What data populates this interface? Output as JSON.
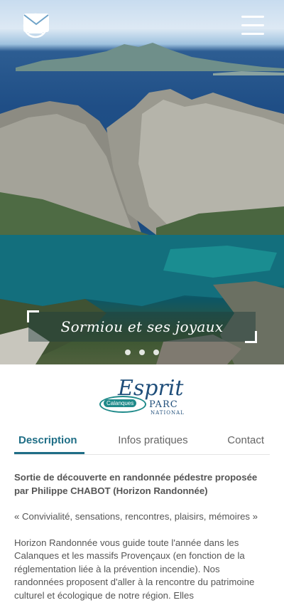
{
  "header": {
    "icons": [
      "user-icon",
      "mail-icon",
      "menu-icon"
    ]
  },
  "hero": {
    "caption": "Sormiou et ses joyaux",
    "slides_count": 3
  },
  "logo": {
    "word1": "Esprit",
    "word2": "PARC",
    "word3": "NATIONAL",
    "badge": "Calanques"
  },
  "tabs": [
    {
      "label": "Description"
    },
    {
      "label": "Infos pratiques"
    },
    {
      "label": "Contact"
    }
  ],
  "content": {
    "intro": "Sortie de découverte en randonnée pédestre proposée par Philippe CHABOT (Horizon Randonnée)",
    "quote": "« Convivialité, sensations, rencontres, plaisirs, mémoires »",
    "body": "Horizon Randonnée vous guide toute l'année dans les Calanques et les massifs Provençaux (en fonction de la réglementation liée à la prévention incendie). Nos randonnées proposent d'aller à la rencontre du patrimoine culturel et écologique de notre région. Elles"
  },
  "colors": {
    "accent": "#1f6e86",
    "text": "#555555"
  }
}
